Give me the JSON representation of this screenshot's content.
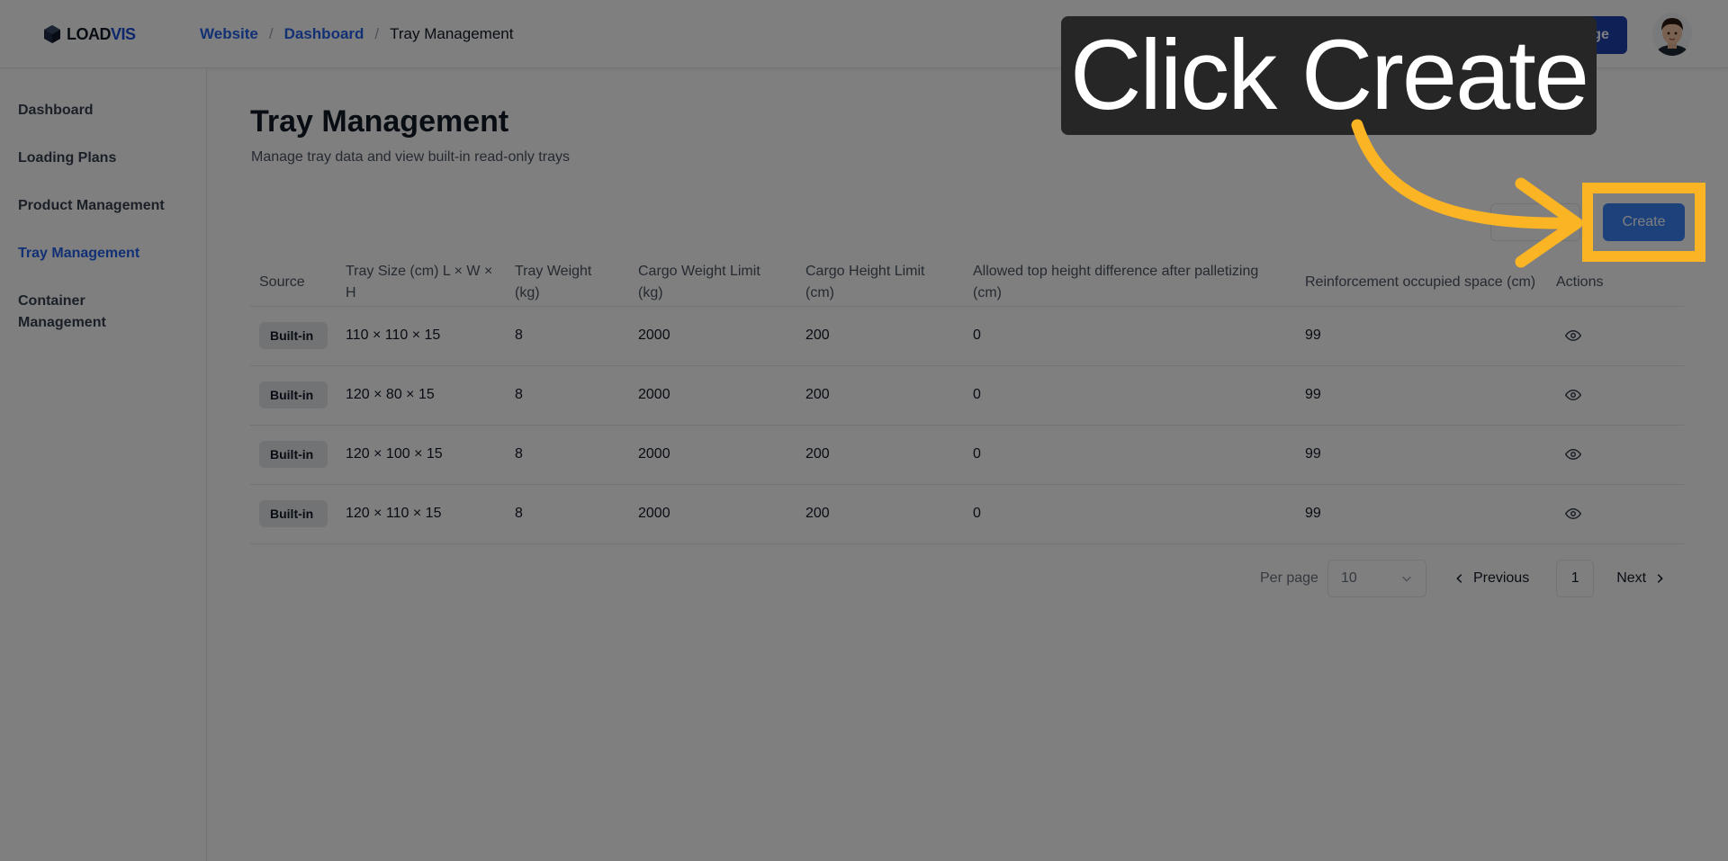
{
  "header": {
    "logo_text_main": "LOAD",
    "logo_text_accent": "VIS",
    "breadcrumbs": [
      "Website",
      "Dashboard",
      "Tray Management"
    ],
    "breadcrumb_separator": "/",
    "recharge_label": "Recharge"
  },
  "sidebar": {
    "items": [
      {
        "label": "Dashboard"
      },
      {
        "label": "Loading Plans"
      },
      {
        "label": "Product Management"
      },
      {
        "label": "Tray Management"
      },
      {
        "label": "Container Management"
      }
    ],
    "active_index": 3
  },
  "main": {
    "title": "Tray Management",
    "subtitle": "Manage tray data and view built-in read-only trays",
    "create_label": "Create"
  },
  "table": {
    "headers": [
      "Source",
      "Tray Size (cm) L × W × H",
      "Tray Weight (kg)",
      "Cargo Weight Limit (kg)",
      "Cargo Height Limit (cm)",
      "Allowed top height difference after palletizing (cm)",
      "Reinforcement occupied space (cm)",
      "Actions"
    ],
    "rows": [
      {
        "source": "Built-in",
        "size": "110 × 110 × 15",
        "weight": "8",
        "cargo_weight": "2000",
        "cargo_height": "200",
        "top_diff": "0",
        "reinforcement": "99"
      },
      {
        "source": "Built-in",
        "size": "120 × 80 × 15",
        "weight": "8",
        "cargo_weight": "2000",
        "cargo_height": "200",
        "top_diff": "0",
        "reinforcement": "99"
      },
      {
        "source": "Built-in",
        "size": "120 × 100 × 15",
        "weight": "8",
        "cargo_weight": "2000",
        "cargo_height": "200",
        "top_diff": "0",
        "reinforcement": "99"
      },
      {
        "source": "Built-in",
        "size": "120 × 110 × 15",
        "weight": "8",
        "cargo_weight": "2000",
        "cargo_height": "200",
        "top_diff": "0",
        "reinforcement": "99"
      }
    ]
  },
  "pagination": {
    "per_page_label": "Per page",
    "per_page_value": "10",
    "previous_label": "Previous",
    "current_page": "1",
    "next_label": "Next"
  },
  "overlay": {
    "callout_text": "Click Create",
    "accent_color": "#fbb423"
  },
  "colors": {
    "primary": "#3b82f6",
    "link": "#2563eb",
    "recharge": "#1e40af"
  }
}
